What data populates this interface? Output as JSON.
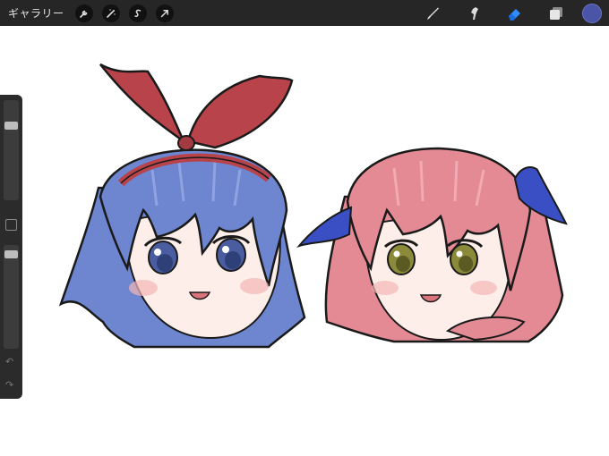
{
  "topbar": {
    "gallery_label": "ギャラリー",
    "left_tools": [
      "wrench-icon",
      "magic-wand-icon",
      "selection-s-icon",
      "transform-arrow-icon"
    ],
    "right_tools": [
      "brush-icon",
      "smudge-icon",
      "eraser-icon",
      "layers-icon"
    ],
    "active_tool": "eraser-icon",
    "current_color": "#4a55a8"
  },
  "sidebar": {
    "brush_size_level": 0.1,
    "opacity_level": 0.05
  },
  "colors": {
    "blue_hair": "#6d86cf",
    "pink_hair": "#e48a95",
    "red_bow": "#b8434a",
    "blue_bow": "#3a4fc4",
    "skin": "#fdeee9",
    "outline": "#1a1a1a"
  }
}
